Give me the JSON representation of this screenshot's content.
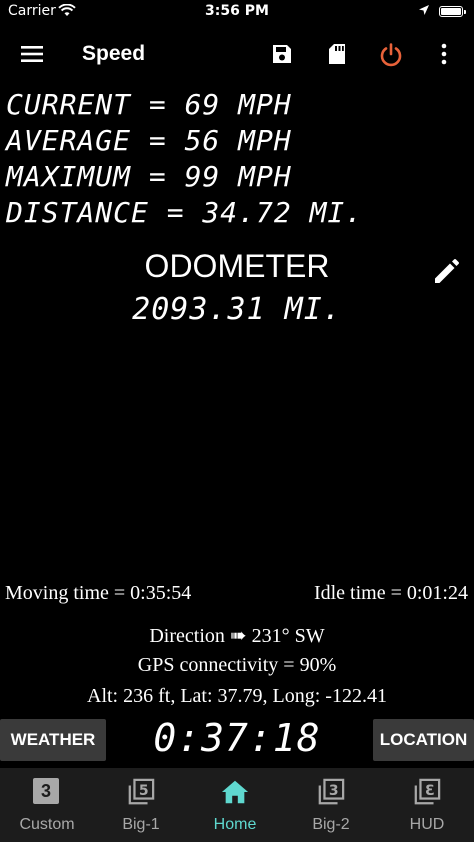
{
  "status_bar": {
    "carrier": "Carrier",
    "time": "3:56 PM"
  },
  "app_bar": {
    "title": "Speed"
  },
  "stats": {
    "current": "CURRENT = 69 MPH",
    "average": "AVERAGE = 56 MPH",
    "maximum": "MAXIMUM = 99 MPH",
    "distance": "DISTANCE = 34.72 MI."
  },
  "odometer": {
    "title": "ODOMETER",
    "value": "2093.31 MI."
  },
  "info": {
    "moving_time": "Moving time = 0:35:54",
    "idle_time": "Idle time = 0:01:24",
    "direction": "Direction ➠ 231° SW",
    "gps": "GPS connectivity = 90%",
    "position": "Alt: 236 ft, Lat: 37.79, Long: -122.41"
  },
  "bottom_controls": {
    "weather_label": "WEATHER",
    "timer": "0:37:18",
    "location_label": "LOCATION"
  },
  "tabs": [
    {
      "label": "Custom",
      "icon": "3"
    },
    {
      "label": "Big-1",
      "icon": "5"
    },
    {
      "label": "Home",
      "icon": "home"
    },
    {
      "label": "Big-2",
      "icon": "3"
    },
    {
      "label": "HUD",
      "icon": "3"
    }
  ],
  "colors": {
    "accent_active_tab": "#5fd8cf",
    "power_icon": "#e8623a",
    "button_bg": "#3a3a3a"
  }
}
